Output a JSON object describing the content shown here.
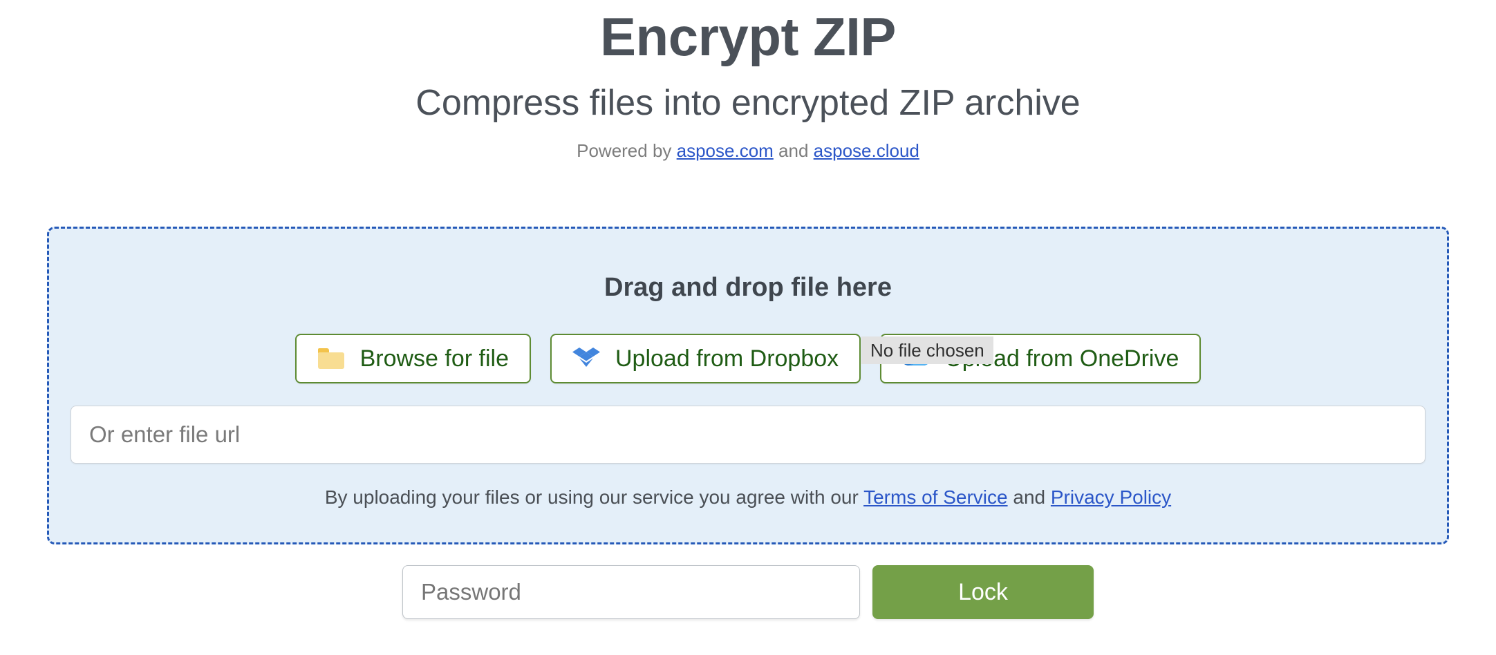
{
  "header": {
    "title": "Encrypt ZIP",
    "subtitle": "Compress files into encrypted ZIP archive",
    "powered_prefix": "Powered by ",
    "powered_link1": "aspose.com",
    "powered_between": " and ",
    "powered_link2": "aspose.cloud"
  },
  "dropzone": {
    "heading": "Drag and drop file here",
    "sources": [
      {
        "label": "Browse for file",
        "icon": "folder-icon"
      },
      {
        "label": "Upload from Dropbox",
        "icon": "dropbox-icon"
      },
      {
        "label": "Upload from OneDrive",
        "icon": "onedrive-icon"
      }
    ],
    "url_placeholder": "Or enter file url",
    "url_value": "",
    "terms_prefix": "By uploading your files or using our service you agree with our ",
    "terms_link1": "Terms of Service",
    "terms_between": " and ",
    "terms_link2": "Privacy Policy"
  },
  "tooltip": {
    "text": "No file chosen"
  },
  "actions": {
    "password_placeholder": "Password",
    "password_value": "",
    "lock_label": "Lock"
  },
  "colors": {
    "title_text": "#4b5159",
    "link_blue": "#2b56c8",
    "dropzone_fill": "#e4eff9",
    "dropzone_border": "#2559b8",
    "source_button_border": "#5d8b33",
    "source_button_text": "#1f5c14",
    "lock_green": "#74a048",
    "tooltip_bg": "#e2e2e2",
    "dropbox_blue": "#4285dd",
    "onedrive_blue": "#3f9bea",
    "folder_yellow": "#f8dd92"
  }
}
